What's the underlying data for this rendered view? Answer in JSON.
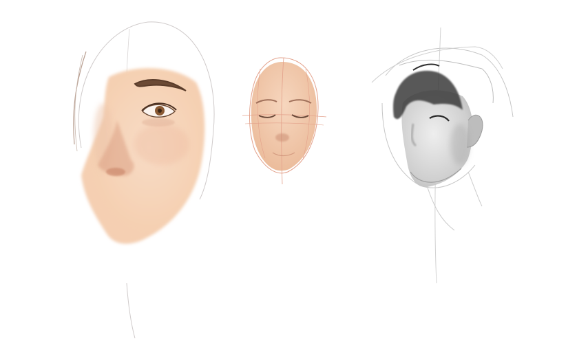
{
  "canvas": {
    "background": "#ffffff"
  },
  "sketches": [
    {
      "name": "realistic-face-sketch",
      "style": "painted",
      "skin_color": "#f6d2b6",
      "shadow_color": "#e3a98a",
      "brow_color": "#6b4a35",
      "iris_color": "#8a5a34",
      "line_color": "#c9c4c4"
    },
    {
      "name": "closed-eyes-face-sketch",
      "style": "painted",
      "skin_color": "#f2c6a8",
      "shadow_color": "#d9a387",
      "line_color": "#e3a08a",
      "brow_color": "#a0705a"
    },
    {
      "name": "grayscale-face-sketch",
      "style": "grayscale",
      "skin_color": "#d8d8d8",
      "shadow_color": "#a9a9a9",
      "hair_color": "#3a3a3a",
      "line_color": "#bdbdbd"
    }
  ]
}
